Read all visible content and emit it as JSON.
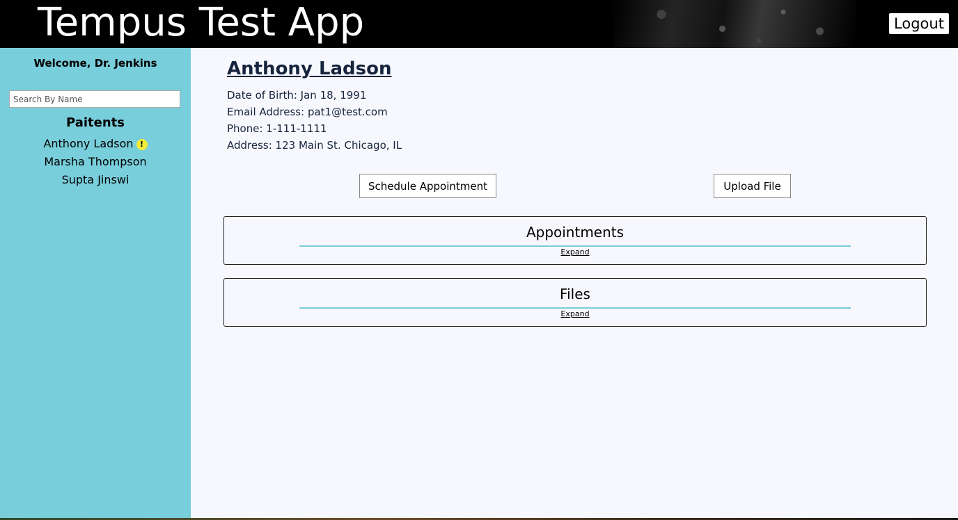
{
  "header": {
    "app_title": "Tempus Test App",
    "logout_label": "Logout"
  },
  "sidebar": {
    "welcome": "Welcome, Dr. Jenkins",
    "search_placeholder": "Search By Name",
    "patients_heading": "Paitents",
    "patients": [
      {
        "name": "Anthony Ladson",
        "alert": true,
        "alert_icon": "exclamation-alert-icon",
        "alert_symbol": "!"
      },
      {
        "name": "Marsha Thompson",
        "alert": false
      },
      {
        "name": "Supta Jinswi",
        "alert": false
      }
    ]
  },
  "patient": {
    "name": "Anthony Ladson",
    "dob": "Date of Birth: Jan 18, 1991",
    "email": "Email Address: pat1@test.com",
    "phone": "Phone: 1-111-1111",
    "address": "Address: 123 Main St. Chicago, IL"
  },
  "actions": {
    "schedule_label": "Schedule Appointment",
    "upload_label": "Upload File"
  },
  "panels": [
    {
      "title": "Appointments",
      "expand_label": "Expand"
    },
    {
      "title": "Files",
      "expand_label": "Expand"
    }
  ],
  "colors": {
    "sidebar_bg": "#79cedb",
    "header_bg": "#000000",
    "main_bg": "#f7f8fd",
    "name_color": "#17243d",
    "alert_badge": "#f4ec3a"
  }
}
